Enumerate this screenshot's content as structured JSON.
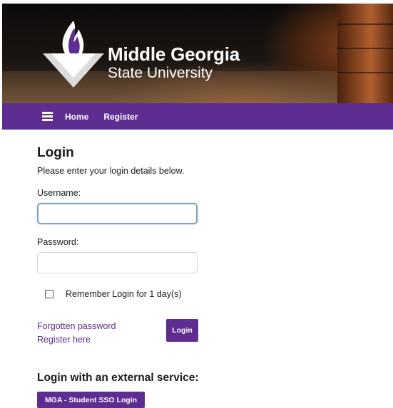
{
  "logo": {
    "line1": "Middle Georgia",
    "line2": "State University"
  },
  "nav": {
    "home": "Home",
    "register": "Register"
  },
  "login": {
    "title": "Login",
    "intro": "Please enter your login details below.",
    "username_label": "Username:",
    "username_value": "",
    "password_label": "Password:",
    "password_value": "",
    "remember_label": "Remember Login for 1 day(s)",
    "remember_checked": false,
    "forgotten_link": "Forgotten password",
    "register_link": "Register here",
    "login_button": "Login"
  },
  "external": {
    "title": "Login with an external service:",
    "sso_button": "MGA - Student SSO Login"
  },
  "colors": {
    "brand_purple": "#5d2d91",
    "focus_border": "#7fa3c8"
  },
  "icons": {
    "menu": "hamburger-menu-icon",
    "logo": "flame-torch-logo-icon"
  }
}
